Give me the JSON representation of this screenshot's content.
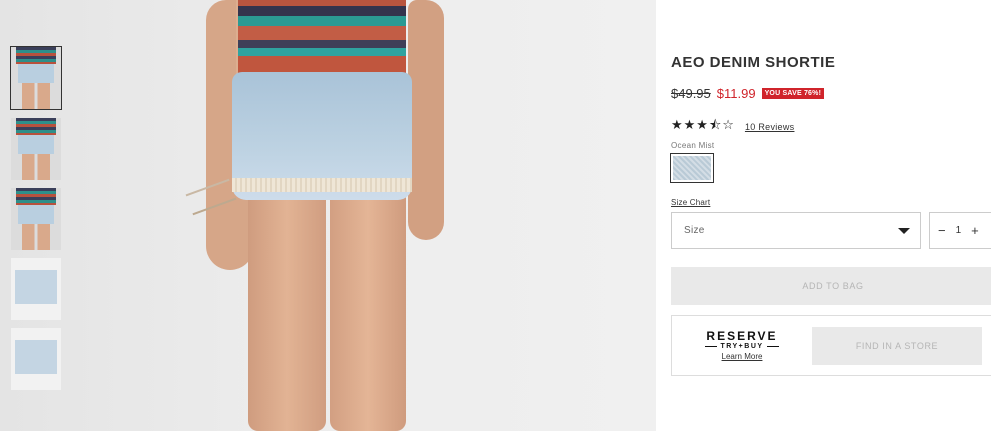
{
  "gallery": {
    "thumbnails": [
      {
        "name": "front-view",
        "active": true
      },
      {
        "name": "side-view",
        "active": false
      },
      {
        "name": "back-view",
        "active": false
      },
      {
        "name": "flat-front",
        "active": false
      },
      {
        "name": "flat-back",
        "active": false
      }
    ]
  },
  "product": {
    "title": "AEO DENIM SHORTIE",
    "price_original": "$49.95",
    "price_sale": "$11.99",
    "save_badge": "YOU SAVE 76%!",
    "rating_stars": "★★★⯪☆",
    "rating_value": 3.5,
    "reviews_link": "10 Reviews",
    "color_name": "Ocean Mist",
    "size_chart_link": "Size Chart",
    "size_select_label": "Size",
    "qty_minus": "−",
    "qty_value": "1",
    "qty_plus": "+",
    "add_to_bag_label": "ADD TO BAG"
  },
  "reserve": {
    "logo_word": "RESERVE",
    "logo_sub": "TRY+BUY",
    "learn_more": "Learn More",
    "find_store_label": "FIND IN A STORE"
  },
  "colors": {
    "sale_red": "#d0242b",
    "disabled_button": "#e9e9e9",
    "disabled_text": "#b5b5b5"
  }
}
